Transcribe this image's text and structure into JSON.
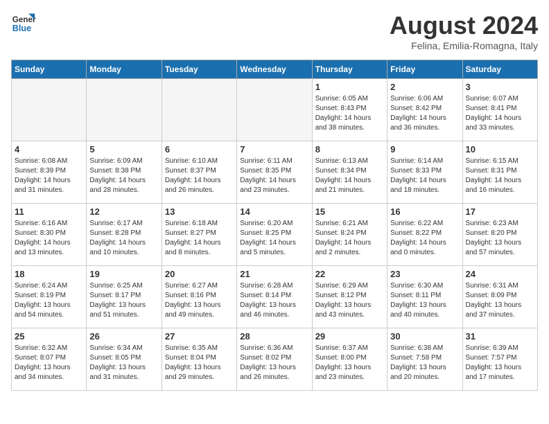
{
  "header": {
    "logo_line1": "General",
    "logo_line2": "Blue",
    "month_year": "August 2024",
    "location": "Felina, Emilia-Romagna, Italy"
  },
  "weekdays": [
    "Sunday",
    "Monday",
    "Tuesday",
    "Wednesday",
    "Thursday",
    "Friday",
    "Saturday"
  ],
  "weeks": [
    [
      {
        "day": "",
        "info": ""
      },
      {
        "day": "",
        "info": ""
      },
      {
        "day": "",
        "info": ""
      },
      {
        "day": "",
        "info": ""
      },
      {
        "day": "1",
        "info": "Sunrise: 6:05 AM\nSunset: 8:43 PM\nDaylight: 14 hours\nand 38 minutes."
      },
      {
        "day": "2",
        "info": "Sunrise: 6:06 AM\nSunset: 8:42 PM\nDaylight: 14 hours\nand 36 minutes."
      },
      {
        "day": "3",
        "info": "Sunrise: 6:07 AM\nSunset: 8:41 PM\nDaylight: 14 hours\nand 33 minutes."
      }
    ],
    [
      {
        "day": "4",
        "info": "Sunrise: 6:08 AM\nSunset: 8:39 PM\nDaylight: 14 hours\nand 31 minutes."
      },
      {
        "day": "5",
        "info": "Sunrise: 6:09 AM\nSunset: 8:38 PM\nDaylight: 14 hours\nand 28 minutes."
      },
      {
        "day": "6",
        "info": "Sunrise: 6:10 AM\nSunset: 8:37 PM\nDaylight: 14 hours\nand 26 minutes."
      },
      {
        "day": "7",
        "info": "Sunrise: 6:11 AM\nSunset: 8:35 PM\nDaylight: 14 hours\nand 23 minutes."
      },
      {
        "day": "8",
        "info": "Sunrise: 6:13 AM\nSunset: 8:34 PM\nDaylight: 14 hours\nand 21 minutes."
      },
      {
        "day": "9",
        "info": "Sunrise: 6:14 AM\nSunset: 8:33 PM\nDaylight: 14 hours\nand 18 minutes."
      },
      {
        "day": "10",
        "info": "Sunrise: 6:15 AM\nSunset: 8:31 PM\nDaylight: 14 hours\nand 16 minutes."
      }
    ],
    [
      {
        "day": "11",
        "info": "Sunrise: 6:16 AM\nSunset: 8:30 PM\nDaylight: 14 hours\nand 13 minutes."
      },
      {
        "day": "12",
        "info": "Sunrise: 6:17 AM\nSunset: 8:28 PM\nDaylight: 14 hours\nand 10 minutes."
      },
      {
        "day": "13",
        "info": "Sunrise: 6:18 AM\nSunset: 8:27 PM\nDaylight: 14 hours\nand 8 minutes."
      },
      {
        "day": "14",
        "info": "Sunrise: 6:20 AM\nSunset: 8:25 PM\nDaylight: 14 hours\nand 5 minutes."
      },
      {
        "day": "15",
        "info": "Sunrise: 6:21 AM\nSunset: 8:24 PM\nDaylight: 14 hours\nand 2 minutes."
      },
      {
        "day": "16",
        "info": "Sunrise: 6:22 AM\nSunset: 8:22 PM\nDaylight: 14 hours\nand 0 minutes."
      },
      {
        "day": "17",
        "info": "Sunrise: 6:23 AM\nSunset: 8:20 PM\nDaylight: 13 hours\nand 57 minutes."
      }
    ],
    [
      {
        "day": "18",
        "info": "Sunrise: 6:24 AM\nSunset: 8:19 PM\nDaylight: 13 hours\nand 54 minutes."
      },
      {
        "day": "19",
        "info": "Sunrise: 6:25 AM\nSunset: 8:17 PM\nDaylight: 13 hours\nand 51 minutes."
      },
      {
        "day": "20",
        "info": "Sunrise: 6:27 AM\nSunset: 8:16 PM\nDaylight: 13 hours\nand 49 minutes."
      },
      {
        "day": "21",
        "info": "Sunrise: 6:28 AM\nSunset: 8:14 PM\nDaylight: 13 hours\nand 46 minutes."
      },
      {
        "day": "22",
        "info": "Sunrise: 6:29 AM\nSunset: 8:12 PM\nDaylight: 13 hours\nand 43 minutes."
      },
      {
        "day": "23",
        "info": "Sunrise: 6:30 AM\nSunset: 8:11 PM\nDaylight: 13 hours\nand 40 minutes."
      },
      {
        "day": "24",
        "info": "Sunrise: 6:31 AM\nSunset: 8:09 PM\nDaylight: 13 hours\nand 37 minutes."
      }
    ],
    [
      {
        "day": "25",
        "info": "Sunrise: 6:32 AM\nSunset: 8:07 PM\nDaylight: 13 hours\nand 34 minutes."
      },
      {
        "day": "26",
        "info": "Sunrise: 6:34 AM\nSunset: 8:05 PM\nDaylight: 13 hours\nand 31 minutes."
      },
      {
        "day": "27",
        "info": "Sunrise: 6:35 AM\nSunset: 8:04 PM\nDaylight: 13 hours\nand 29 minutes."
      },
      {
        "day": "28",
        "info": "Sunrise: 6:36 AM\nSunset: 8:02 PM\nDaylight: 13 hours\nand 26 minutes."
      },
      {
        "day": "29",
        "info": "Sunrise: 6:37 AM\nSunset: 8:00 PM\nDaylight: 13 hours\nand 23 minutes."
      },
      {
        "day": "30",
        "info": "Sunrise: 6:38 AM\nSunset: 7:58 PM\nDaylight: 13 hours\nand 20 minutes."
      },
      {
        "day": "31",
        "info": "Sunrise: 6:39 AM\nSunset: 7:57 PM\nDaylight: 13 hours\nand 17 minutes."
      }
    ]
  ]
}
